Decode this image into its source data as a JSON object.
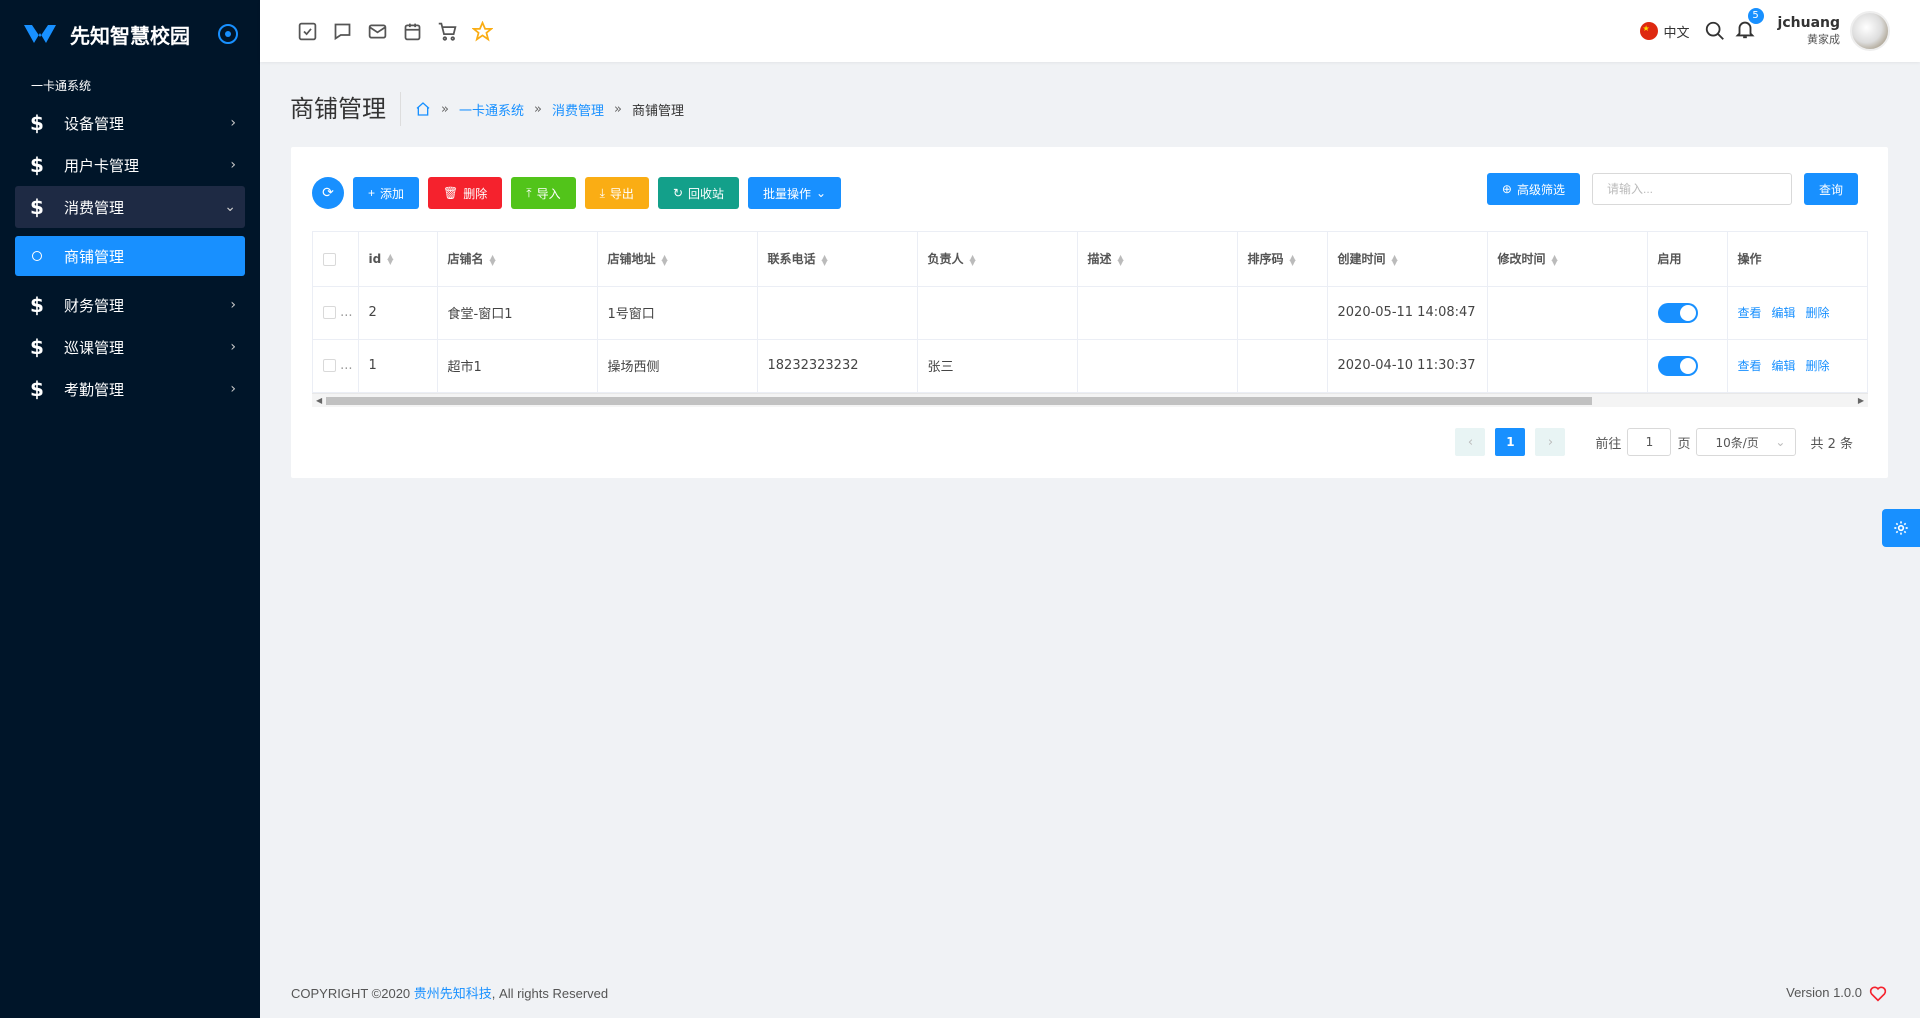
{
  "brand": {
    "name": "先知智慧校园"
  },
  "sidebar": {
    "section_label": "一卡通系统",
    "items": [
      {
        "label": "设备管理",
        "icon": "dollar-icon"
      },
      {
        "label": "用户卡管理",
        "icon": "dollar-icon"
      },
      {
        "label": "消费管理",
        "icon": "dollar-icon",
        "open": true
      },
      {
        "label": "商铺管理",
        "sub": true,
        "active": true
      },
      {
        "label": "财务管理",
        "icon": "dollar-icon"
      },
      {
        "label": "巡课管理",
        "icon": "dollar-icon"
      },
      {
        "label": "考勤管理",
        "icon": "dollar-icon"
      }
    ]
  },
  "header": {
    "tool_icons": [
      "checkbox-icon",
      "chat-icon",
      "mail-icon",
      "calendar-icon",
      "cart-icon",
      "star-icon"
    ],
    "language": "中文",
    "notification_count": "5",
    "user_name": "jchuang",
    "user_sub": "黄家成"
  },
  "page": {
    "title": "商铺管理",
    "breadcrumb": [
      "一卡通系统",
      "消费管理",
      "商铺管理"
    ]
  },
  "toolbar": {
    "add": "添加",
    "delete": "删除",
    "import": "导入",
    "export": "导出",
    "recycle": "回收站",
    "batch": "批量操作",
    "advanced_filter": "高级筛选",
    "search_placeholder": "请输入...",
    "query": "查询"
  },
  "table": {
    "columns": [
      "id",
      "店铺名",
      "店铺地址",
      "联系电话",
      "负责人",
      "描述",
      "排序码",
      "创建时间",
      "修改时间",
      "启用",
      "操作"
    ],
    "rows": [
      {
        "ellipsis": "...",
        "id": "2",
        "name": "食堂-窗口1",
        "address": "1号窗口",
        "phone": "",
        "owner": "",
        "desc": "",
        "sort": "",
        "created": "2020-05-11 14:08:47",
        "modified": "",
        "enabled": true
      },
      {
        "ellipsis": "...",
        "id": "1",
        "name": "超市1",
        "address": "操场西侧",
        "phone": "18232323232",
        "owner": "张三",
        "desc": "",
        "sort": "",
        "created": "2020-04-10 11:30:37",
        "modified": "",
        "enabled": true
      }
    ],
    "actions": [
      "查看",
      "编辑",
      "删除"
    ]
  },
  "pagination": {
    "current": "1",
    "goto_label": "前往",
    "goto_value": "1",
    "page_unit": "页",
    "page_size": "10条/页",
    "total": "共 2 条"
  },
  "footer": {
    "copyright_prefix": "COPYRIGHT ©2020 ",
    "company": "贵州先知科技",
    "copyright_suffix": ", All rights Reserved",
    "version": "Version 1.0.0"
  },
  "colors": {
    "primary": "#1890ff",
    "sidebar_bg": "#001529",
    "danger": "#f5222d",
    "success": "#52c41a",
    "warning": "#faad14",
    "teal": "#13a08a"
  }
}
